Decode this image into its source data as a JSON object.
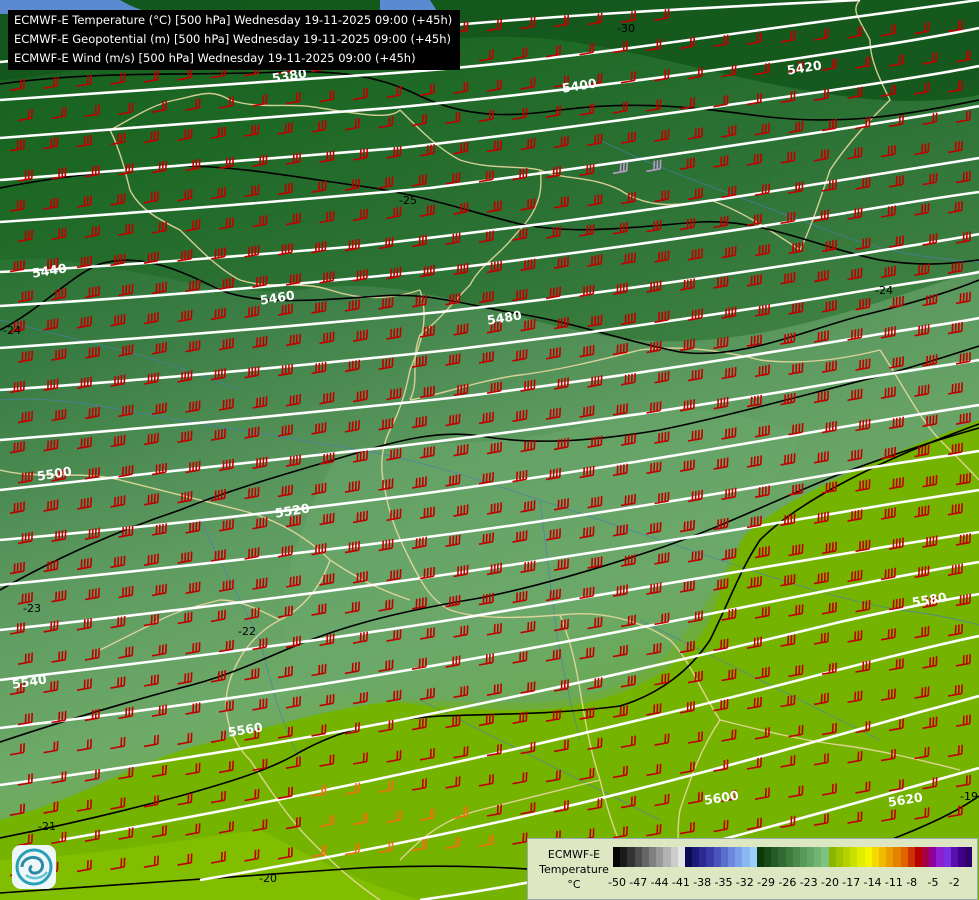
{
  "map": {
    "title_lines": [
      "ECMWF-E Temperature (°C) [500 hPa] Wednesday 19-11-2025 09:00 (+45h)",
      "ECMWF-E Geopotential (m) [500 hPa] Wednesday 19-11-2025 09:00 (+45h)",
      "ECMWF-E Wind (m/s) [500 hPa] Wednesday 19-11-2025 09:00 (+45h)"
    ],
    "geopotential_labels": [
      "5380",
      "5400",
      "5420",
      "5440",
      "5460",
      "5480",
      "5500",
      "5520",
      "5540",
      "5560",
      "5580",
      "5600",
      "5620"
    ],
    "temperature_labels": [
      "-30",
      "-25",
      "-24",
      "-24",
      "-23",
      "-22",
      "-21",
      "-20",
      "-19"
    ],
    "colors": {
      "wind_barb": "#c00000",
      "wind_barb_light": "#bb99cc",
      "wind_barb_warm": "#ee7010",
      "contour_geopotential": "#ffffff",
      "contour_temperature": "#000000",
      "borders": "#e8d9a0",
      "rivers": "#4a7fb0"
    }
  },
  "legend": {
    "title_line1": "ECMWF-E",
    "title_line2": "Temperature",
    "unit": "°C",
    "ticks": [
      "-50",
      "-47",
      "-44",
      "-41",
      "-38",
      "-35",
      "-32",
      "-29",
      "-26",
      "-23",
      "-20",
      "-17",
      "-14",
      "-11",
      "-8",
      "-5",
      "-2"
    ],
    "colors": [
      "#050505",
      "#1a1a1a",
      "#333333",
      "#4d4d4d",
      "#666666",
      "#808080",
      "#999999",
      "#b3b3b3",
      "#cccccc",
      "#e6e6e6",
      "#0a0a55",
      "#1a1a7a",
      "#2a2a90",
      "#3a3aa8",
      "#4a55bb",
      "#5a6fcc",
      "#6a88dd",
      "#7aa0ea",
      "#8ab8f2",
      "#9ccfff",
      "#0a3a0a",
      "#174a17",
      "#245a24",
      "#316a31",
      "#3e7a3e",
      "#4b8a4b",
      "#589858",
      "#65a665",
      "#72b472",
      "#80c080",
      "#8ab500",
      "#a0c400",
      "#b5d200",
      "#cae000",
      "#e0ee00",
      "#f5f500",
      "#f5d800",
      "#f0bb00",
      "#eb9e00",
      "#e68100",
      "#e06400",
      "#cc3300",
      "#b80000",
      "#a40040",
      "#9000a0",
      "#8a20d0",
      "#7a30e0",
      "#5a10b0",
      "#40008a",
      "#30006a"
    ]
  },
  "logo": {
    "name": "ecmwf-logo"
  }
}
